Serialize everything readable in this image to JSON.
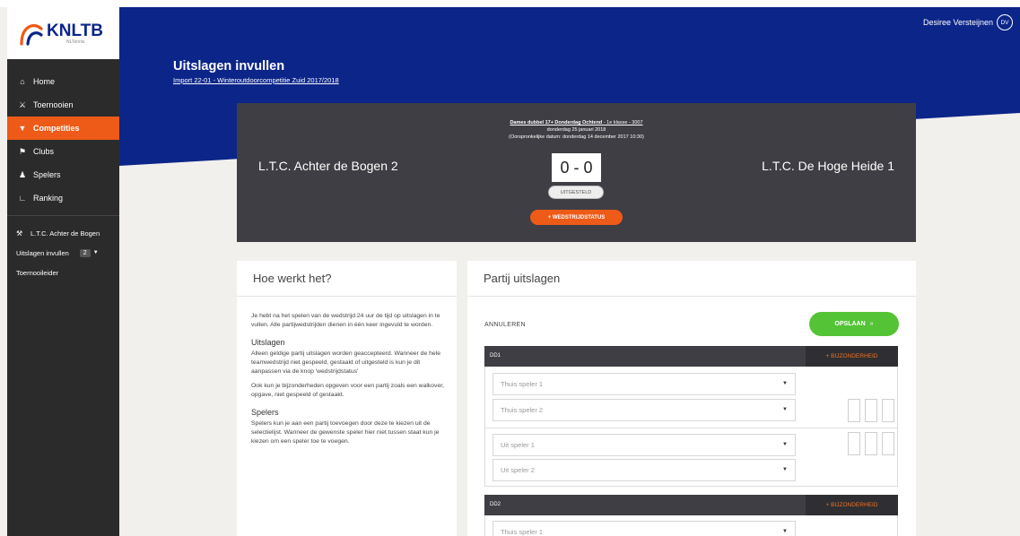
{
  "brand": {
    "logo_text": "KNLTB",
    "logo_sub": "NLTennis"
  },
  "user": {
    "name": "Desiree Versteijnen",
    "initials": "DV"
  },
  "sidebar": {
    "items": [
      {
        "label": "Home",
        "icon": "home-icon"
      },
      {
        "label": "Toernooien",
        "icon": "trophy-icon"
      },
      {
        "label": "Competities",
        "icon": "cup-icon",
        "active": true
      },
      {
        "label": "Clubs",
        "icon": "flag-icon"
      },
      {
        "label": "Spelers",
        "icon": "players-icon"
      },
      {
        "label": "Ranking",
        "icon": "chart-icon"
      }
    ],
    "club": "L.T.C. Achter de Bogen",
    "sub_items": [
      {
        "label": "Uitslagen invullen",
        "badge": "2"
      },
      {
        "label": "Toernooileider"
      }
    ]
  },
  "header": {
    "title": "Uitslagen invullen",
    "subtitle": "Import 22-01 - Winteroutdoorcompetitie Zuid 2017/2018"
  },
  "match": {
    "category_bold": "Dames dubbel 17+ Donderdag Ochtend",
    "category_rest": " - 1e klasse - 3007",
    "date": "donderdag 25 januari 2018",
    "original_date": "(Oorspronkelijke datum: donderdag 14 december 2017 10:30)",
    "home_team": "L.T.C. Achter de Bogen 2",
    "away_team": "L.T.C. De Hoge Heide 1",
    "score": "0 - 0",
    "status": "UITGESTELD",
    "status_button": "+ WEDSTRIJDSTATUS"
  },
  "how": {
    "title": "Hoe werkt het?",
    "intro": "Je hebt na het spelen van de wedstrijd 24 uur de tijd op uitslagen in te vullen. Alle partijwedstrijden dienen in één keer ingevuld te worden.",
    "h1": "Uitslagen",
    "p1": "Alleen geldige partij uitslagen worden geaccepteerd. Wanneer de hele teamwedstrijd niet gespeeld, gestaakt of uitgesteld is kun je dit aanpassen via de knop 'wedstrijdstatus'",
    "p2": "Ook kun je bijzonderheden opgeven voor een partij zoals een walkover, opgave, niet gespeeld of gestaakt.",
    "h2": "Spelers",
    "p3": "Spelers kun je aan een partij toevoegen door deze te kiezen uit de selectielijst. Wanneer de gewenste speler hier niet tussen staat kun je kiezen om een speler toe te voegen."
  },
  "partij": {
    "title": "Partij uitslagen",
    "cancel": "ANNULEREN",
    "save": "OPSLAAN",
    "save_arrow": "»",
    "special": "+ BIJZONDERHEID",
    "sections": [
      {
        "label": "DD1",
        "home1": "Thuis speler 1",
        "home2": "Thuis speler 2",
        "away1": "Uit speler 1",
        "away2": "Uit speler 2"
      },
      {
        "label": "DD2",
        "home1": "Thuis speler 1"
      }
    ]
  },
  "colors": {
    "navy": "#0c2589",
    "orange": "#ee5a17",
    "green": "#54c436",
    "dark": "#3e3e44",
    "sidebar": "#2b2b2b"
  }
}
